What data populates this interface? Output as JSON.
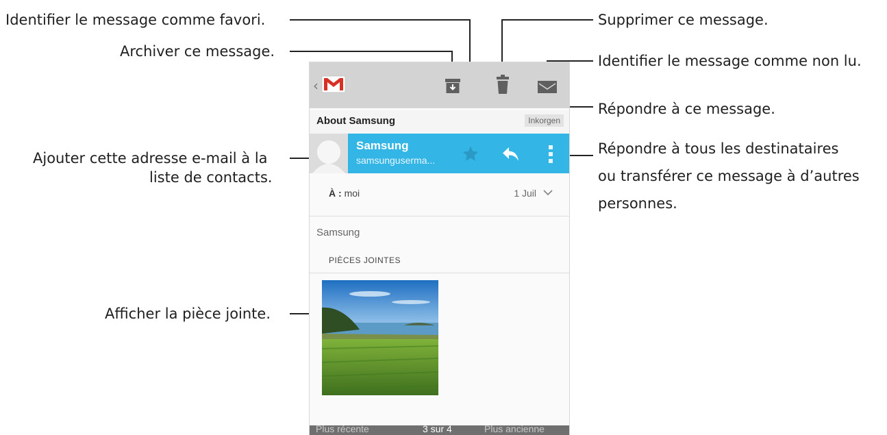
{
  "callouts": {
    "favorite": "Identifier le message comme favori.",
    "archive": "Archiver ce message.",
    "add_contact_line1": "Ajouter cette adresse e-mail à la",
    "add_contact_line2": "liste de contacts.",
    "view_attachment": "Afficher la pièce jointe.",
    "delete": "Supprimer ce message.",
    "mark_unread": "Identifier le message comme non lu.",
    "reply": "Répondre à ce message.",
    "reply_all_line1": "Répondre à tous les destinataires",
    "reply_all_line2": "ou transférer ce message à d’autres",
    "reply_all_line3": "personnes."
  },
  "action_bar": {
    "up_caret": "‹",
    "icons": [
      "gmail-logo",
      "archive-icon",
      "trash-icon",
      "envelope-icon"
    ]
  },
  "message": {
    "subject": "About Samsung",
    "label": "Inkorgen",
    "sender_name": "Samsung",
    "sender_email": "samsunguserma...",
    "to_prefix": "À :",
    "to_value": "moi",
    "date": "1 Juil",
    "body": "Samsung",
    "attachments_header": "PIÈCES JOINTES"
  },
  "bottom_bar": {
    "newer": "Plus récente",
    "counter": "3 sur 4",
    "older": "Plus ancienne"
  },
  "colors": {
    "accent": "#33b5e5",
    "action_bar": "#d3d3d3",
    "bottom_bar": "#6f6f6f",
    "gmail_red": "#d93025"
  }
}
